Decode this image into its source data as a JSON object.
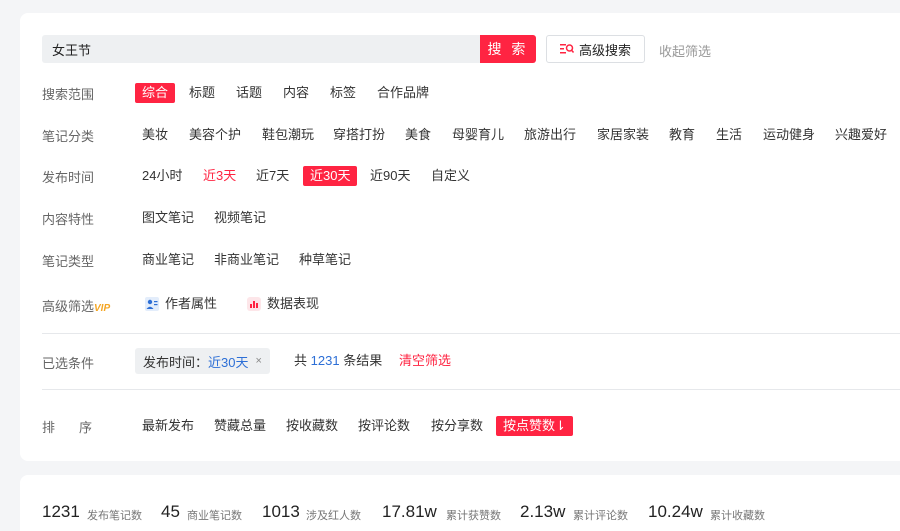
{
  "search": {
    "value": "女王节",
    "button_label": "搜 索",
    "advanced_label": "高级搜索",
    "collapse_label": "收起筛选"
  },
  "rows": {
    "scope": {
      "label": "搜索范围",
      "options": [
        "综合",
        "标题",
        "话题",
        "内容",
        "标签",
        "合作品牌"
      ]
    },
    "category": {
      "label": "笔记分类",
      "options": [
        "美妆",
        "美容个护",
        "鞋包潮玩",
        "穿搭打扮",
        "美食",
        "母婴育儿",
        "旅游出行",
        "家居家装",
        "教育",
        "生活",
        "运动健身",
        "兴趣爱好"
      ]
    },
    "time": {
      "label": "发布时间",
      "options": [
        "24小时",
        "近3天",
        "近7天",
        "近30天",
        "近90天",
        "自定义"
      ]
    },
    "content": {
      "label": "内容特性",
      "options": [
        "图文笔记",
        "视频笔记"
      ]
    },
    "type": {
      "label": "笔记类型",
      "options": [
        "商业笔记",
        "非商业笔记",
        "种草笔记"
      ]
    },
    "advanced": {
      "label": "高级筛选",
      "vip": "VIP",
      "options": [
        "作者属性",
        "数据表现"
      ]
    }
  },
  "selected": {
    "label": "已选条件",
    "chip_key": "发布时间：",
    "chip_value": "近30天",
    "chip_close": "×",
    "result_prefix": "共",
    "result_count": "1231",
    "result_suffix": "条结果",
    "clear_label": "清空筛选"
  },
  "sort": {
    "label_a": "排",
    "label_b": "序",
    "options": [
      "最新发布",
      "赞藏总量",
      "按收藏数",
      "按评论数",
      "按分享数",
      "按点赞数⇂"
    ]
  },
  "stats": [
    {
      "value": "1231",
      "label": "发布笔记数"
    },
    {
      "value": "45",
      "label": "商业笔记数"
    },
    {
      "value": "1013",
      "label": "涉及红人数"
    },
    {
      "value": "17.81w",
      "label": "累计获赞数"
    },
    {
      "value": "2.13w",
      "label": "累计评论数"
    },
    {
      "value": "10.24w",
      "label": "累计收藏数"
    }
  ],
  "colors": {
    "accent": "#ff2442",
    "link": "#2d6fd6",
    "vip": "#f5a623"
  }
}
